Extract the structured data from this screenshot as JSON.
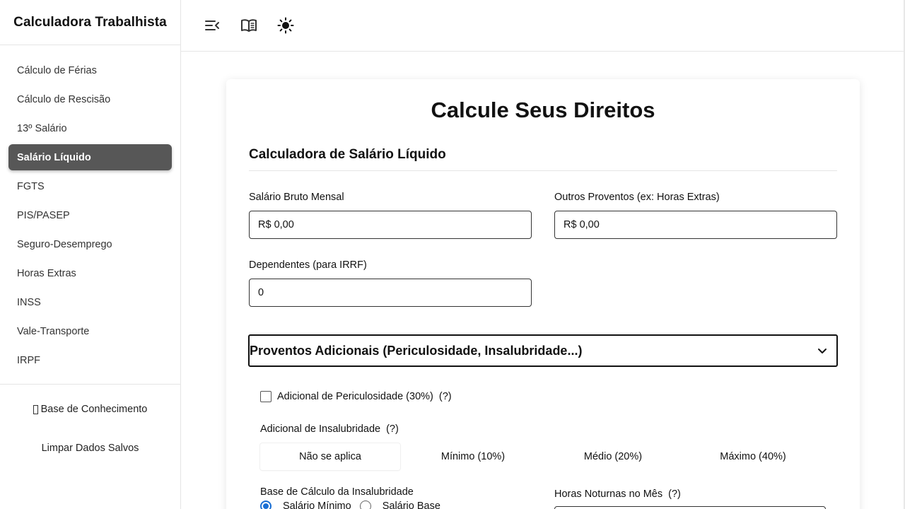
{
  "sidebar": {
    "title": "Calculadora Trabalhista",
    "items": [
      {
        "label": "Cálculo de Férias"
      },
      {
        "label": "Cálculo de Rescisão"
      },
      {
        "label": "13º Salário"
      },
      {
        "label": "Salário Líquido",
        "active": true
      },
      {
        "label": "FGTS"
      },
      {
        "label": "PIS/PASEP"
      },
      {
        "label": "Seguro-Desemprego"
      },
      {
        "label": "Horas Extras"
      },
      {
        "label": "INSS"
      },
      {
        "label": "Vale-Transporte"
      },
      {
        "label": "IRPF"
      }
    ],
    "footer": {
      "knowledge_base": "Base de Conhecimento",
      "clear_data": "Limpar Dados Salvos"
    }
  },
  "topbar": {
    "icons": [
      "collapse-menu-icon",
      "book-icon",
      "sun-icon"
    ]
  },
  "main": {
    "title": "Calcule Seus Direitos",
    "section_title": "Calculadora de Salário Líquido",
    "fields": {
      "gross_label": "Salário Bruto Mensal",
      "gross_value": "R$ 0,00",
      "other_label": "Outros Proventos (ex: Horas Extras)",
      "other_value": "R$ 0,00",
      "dependents_label": "Dependentes (para IRRF)",
      "dependents_value": "0"
    },
    "additional": {
      "header": "Proventos Adicionais (Periculosidade, Insalubridade...)",
      "periculosidade_label": "Adicional de Periculosidade (30%)",
      "periculosidade_help": "(?)",
      "insalubridade_label": "Adicional de Insalubridade",
      "insalubridade_help": "(?)",
      "insalubridade_options": [
        "Não se aplica",
        "Mínimo (10%)",
        "Médio (20%)",
        "Máximo (40%)"
      ],
      "insalubridade_selected": "Não se aplica",
      "base_label": "Base de Cálculo da Insalubridade",
      "base_options": [
        "Salário Mínimo",
        "Salário Base"
      ],
      "base_selected": "Salário Mínimo",
      "night_hours_label": "Horas Noturnas no Mês",
      "night_hours_help": "(?)"
    }
  },
  "colors": {
    "active_nav_bg": "#575757",
    "radio_accent": "#1a6fd4"
  }
}
